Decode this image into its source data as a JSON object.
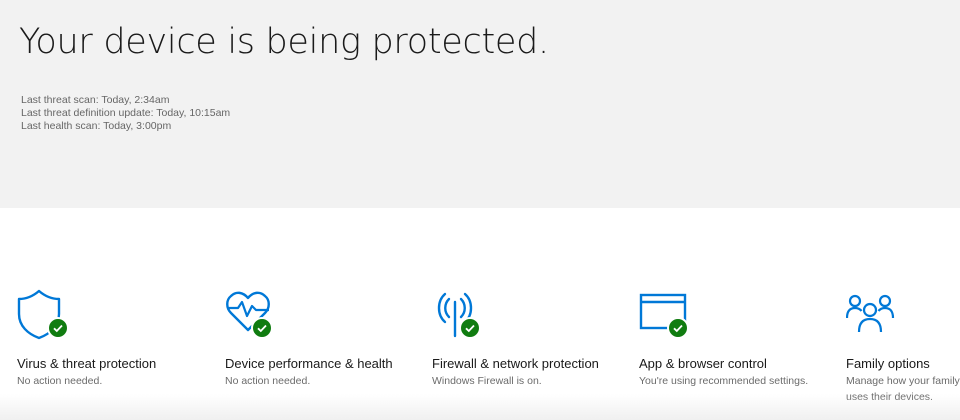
{
  "header": {
    "title": "Your device is being protected.",
    "scan_info": [
      "Last threat scan: Today, 2:34am",
      "Last threat definition update: Today, 10:15am",
      "Last health scan: Today, 3:00pm"
    ]
  },
  "tiles": [
    {
      "icon": "shield-icon",
      "title": "Virus & threat protection",
      "status": "No action needed."
    },
    {
      "icon": "heart-pulse-icon",
      "title": "Device performance & health",
      "status": "No action needed."
    },
    {
      "icon": "antenna-icon",
      "title": "Firewall & network protection",
      "status": "Windows Firewall is on."
    },
    {
      "icon": "browser-window-icon",
      "title": "App & browser control",
      "status": "You're using recommended settings."
    },
    {
      "icon": "family-icon",
      "title": "Family options",
      "status": "Manage how your family uses their devices."
    }
  ],
  "colors": {
    "accent": "#0078d7",
    "status_ok": "#107c10",
    "hero_background": "#f2f2f2"
  }
}
